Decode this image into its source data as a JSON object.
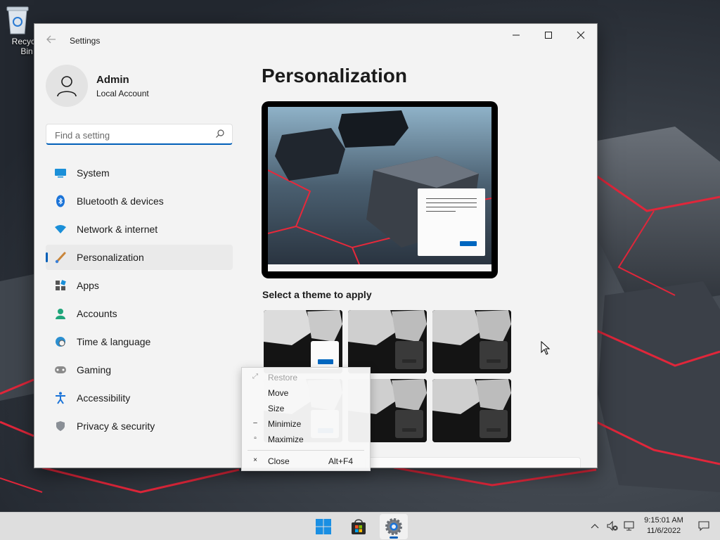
{
  "desktop": {
    "recycle_bin_label": "Recycle Bin"
  },
  "window": {
    "title": "Settings",
    "controls": {
      "minimize": "—",
      "maximize": "☐",
      "close": "✕"
    }
  },
  "profile": {
    "name": "Admin",
    "account_type": "Local Account"
  },
  "search": {
    "placeholder": "Find a setting"
  },
  "nav": {
    "items": [
      {
        "label": "System",
        "icon": "monitor-icon"
      },
      {
        "label": "Bluetooth & devices",
        "icon": "bluetooth-icon"
      },
      {
        "label": "Network & internet",
        "icon": "wifi-icon"
      },
      {
        "label": "Personalization",
        "icon": "brush-icon",
        "selected": true
      },
      {
        "label": "Apps",
        "icon": "apps-icon"
      },
      {
        "label": "Accounts",
        "icon": "person-icon"
      },
      {
        "label": "Time & language",
        "icon": "globe-clock-icon"
      },
      {
        "label": "Gaming",
        "icon": "gamepad-icon"
      },
      {
        "label": "Accessibility",
        "icon": "accessibility-icon"
      },
      {
        "label": "Privacy & security",
        "icon": "shield-icon"
      }
    ]
  },
  "main": {
    "title": "Personalization",
    "theme_section_label": "Select a theme to apply"
  },
  "system_menu": {
    "items": [
      {
        "label": "Restore",
        "glyph": "⤢",
        "disabled": true
      },
      {
        "label": "Move",
        "glyph": "",
        "disabled": false
      },
      {
        "label": "Size",
        "glyph": "",
        "disabled": false
      },
      {
        "label": "Minimize",
        "glyph": "–",
        "disabled": false
      },
      {
        "label": "Maximize",
        "glyph": "▫",
        "disabled": false
      },
      {
        "label": "Close",
        "glyph": "×",
        "shortcut": "Alt+F4",
        "disabled": false
      }
    ]
  },
  "taskbar": {
    "time": "9:15:01 AM",
    "date": "11/6/2022"
  },
  "colors": {
    "accent": "#005fb8",
    "window_bg": "#f3f3f3",
    "taskbar_bg": "#dedede"
  }
}
